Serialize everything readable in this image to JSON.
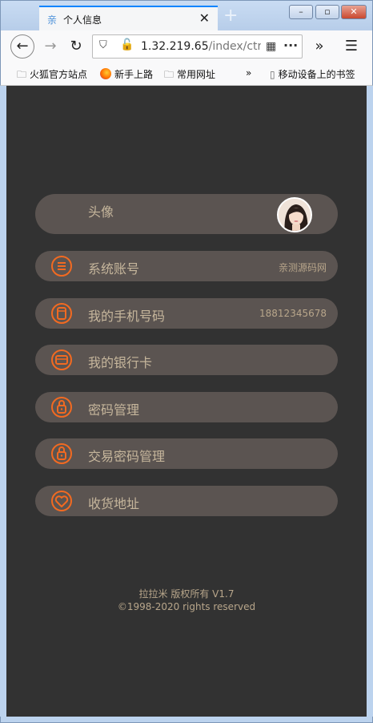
{
  "browser": {
    "tab_title": "个人信息",
    "tab_favicon": "亲",
    "url_main": "1.32.219.65",
    "url_rest": "/index/ctrl/s",
    "bookmarks": [
      "火狐官方站点",
      "新手上路",
      "常用网址",
      "移动设备上的书签"
    ],
    "overflow_glyph": "»"
  },
  "profile": {
    "avatar_label": "头像",
    "items": [
      {
        "label": "系统账号",
        "value": "亲测源码网",
        "icon": "list-icon"
      },
      {
        "label": "我的手机号码",
        "value": "18812345678",
        "icon": "phone-icon"
      },
      {
        "label": "我的银行卡",
        "value": "",
        "icon": "card-icon"
      },
      {
        "label": "密码管理",
        "value": "",
        "icon": "lock-icon"
      },
      {
        "label": "交易密码管理",
        "value": "",
        "icon": "lock-icon"
      },
      {
        "label": "收货地址",
        "value": "",
        "icon": "heart-icon"
      }
    ]
  },
  "footer": {
    "line1": "拉拉米 版权所有 V1.7",
    "line2": "©1998-2020 rights reserved"
  },
  "colors": {
    "accent": "#f26a21",
    "row_bg": "#5b5451",
    "page_bg": "#323232",
    "label": "#c6b69c"
  }
}
